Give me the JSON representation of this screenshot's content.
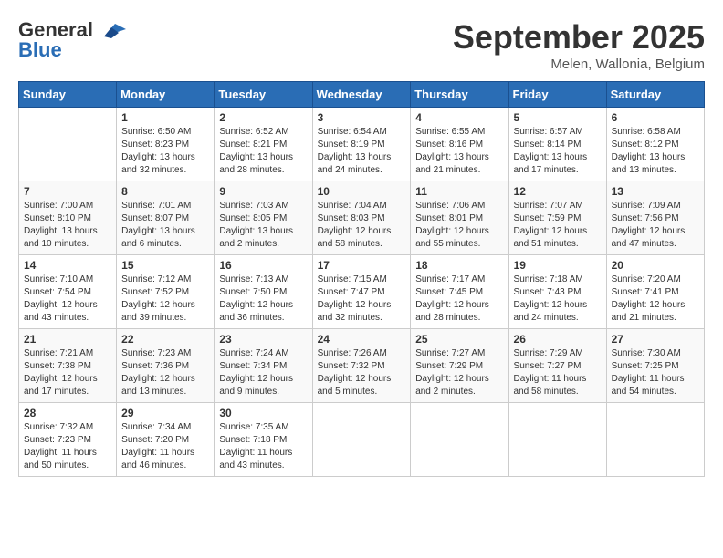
{
  "logo": {
    "line1": "General",
    "line2": "Blue"
  },
  "title": "September 2025",
  "subtitle": "Melen, Wallonia, Belgium",
  "days_header": [
    "Sunday",
    "Monday",
    "Tuesday",
    "Wednesday",
    "Thursday",
    "Friday",
    "Saturday"
  ],
  "weeks": [
    [
      {
        "day": "",
        "info": ""
      },
      {
        "day": "1",
        "info": "Sunrise: 6:50 AM\nSunset: 8:23 PM\nDaylight: 13 hours and 32 minutes."
      },
      {
        "day": "2",
        "info": "Sunrise: 6:52 AM\nSunset: 8:21 PM\nDaylight: 13 hours and 28 minutes."
      },
      {
        "day": "3",
        "info": "Sunrise: 6:54 AM\nSunset: 8:19 PM\nDaylight: 13 hours and 24 minutes."
      },
      {
        "day": "4",
        "info": "Sunrise: 6:55 AM\nSunset: 8:16 PM\nDaylight: 13 hours and 21 minutes."
      },
      {
        "day": "5",
        "info": "Sunrise: 6:57 AM\nSunset: 8:14 PM\nDaylight: 13 hours and 17 minutes."
      },
      {
        "day": "6",
        "info": "Sunrise: 6:58 AM\nSunset: 8:12 PM\nDaylight: 13 hours and 13 minutes."
      }
    ],
    [
      {
        "day": "7",
        "info": "Sunrise: 7:00 AM\nSunset: 8:10 PM\nDaylight: 13 hours and 10 minutes."
      },
      {
        "day": "8",
        "info": "Sunrise: 7:01 AM\nSunset: 8:07 PM\nDaylight: 13 hours and 6 minutes."
      },
      {
        "day": "9",
        "info": "Sunrise: 7:03 AM\nSunset: 8:05 PM\nDaylight: 13 hours and 2 minutes."
      },
      {
        "day": "10",
        "info": "Sunrise: 7:04 AM\nSunset: 8:03 PM\nDaylight: 12 hours and 58 minutes."
      },
      {
        "day": "11",
        "info": "Sunrise: 7:06 AM\nSunset: 8:01 PM\nDaylight: 12 hours and 55 minutes."
      },
      {
        "day": "12",
        "info": "Sunrise: 7:07 AM\nSunset: 7:59 PM\nDaylight: 12 hours and 51 minutes."
      },
      {
        "day": "13",
        "info": "Sunrise: 7:09 AM\nSunset: 7:56 PM\nDaylight: 12 hours and 47 minutes."
      }
    ],
    [
      {
        "day": "14",
        "info": "Sunrise: 7:10 AM\nSunset: 7:54 PM\nDaylight: 12 hours and 43 minutes."
      },
      {
        "day": "15",
        "info": "Sunrise: 7:12 AM\nSunset: 7:52 PM\nDaylight: 12 hours and 39 minutes."
      },
      {
        "day": "16",
        "info": "Sunrise: 7:13 AM\nSunset: 7:50 PM\nDaylight: 12 hours and 36 minutes."
      },
      {
        "day": "17",
        "info": "Sunrise: 7:15 AM\nSunset: 7:47 PM\nDaylight: 12 hours and 32 minutes."
      },
      {
        "day": "18",
        "info": "Sunrise: 7:17 AM\nSunset: 7:45 PM\nDaylight: 12 hours and 28 minutes."
      },
      {
        "day": "19",
        "info": "Sunrise: 7:18 AM\nSunset: 7:43 PM\nDaylight: 12 hours and 24 minutes."
      },
      {
        "day": "20",
        "info": "Sunrise: 7:20 AM\nSunset: 7:41 PM\nDaylight: 12 hours and 21 minutes."
      }
    ],
    [
      {
        "day": "21",
        "info": "Sunrise: 7:21 AM\nSunset: 7:38 PM\nDaylight: 12 hours and 17 minutes."
      },
      {
        "day": "22",
        "info": "Sunrise: 7:23 AM\nSunset: 7:36 PM\nDaylight: 12 hours and 13 minutes."
      },
      {
        "day": "23",
        "info": "Sunrise: 7:24 AM\nSunset: 7:34 PM\nDaylight: 12 hours and 9 minutes."
      },
      {
        "day": "24",
        "info": "Sunrise: 7:26 AM\nSunset: 7:32 PM\nDaylight: 12 hours and 5 minutes."
      },
      {
        "day": "25",
        "info": "Sunrise: 7:27 AM\nSunset: 7:29 PM\nDaylight: 12 hours and 2 minutes."
      },
      {
        "day": "26",
        "info": "Sunrise: 7:29 AM\nSunset: 7:27 PM\nDaylight: 11 hours and 58 minutes."
      },
      {
        "day": "27",
        "info": "Sunrise: 7:30 AM\nSunset: 7:25 PM\nDaylight: 11 hours and 54 minutes."
      }
    ],
    [
      {
        "day": "28",
        "info": "Sunrise: 7:32 AM\nSunset: 7:23 PM\nDaylight: 11 hours and 50 minutes."
      },
      {
        "day": "29",
        "info": "Sunrise: 7:34 AM\nSunset: 7:20 PM\nDaylight: 11 hours and 46 minutes."
      },
      {
        "day": "30",
        "info": "Sunrise: 7:35 AM\nSunset: 7:18 PM\nDaylight: 11 hours and 43 minutes."
      },
      {
        "day": "",
        "info": ""
      },
      {
        "day": "",
        "info": ""
      },
      {
        "day": "",
        "info": ""
      },
      {
        "day": "",
        "info": ""
      }
    ]
  ]
}
